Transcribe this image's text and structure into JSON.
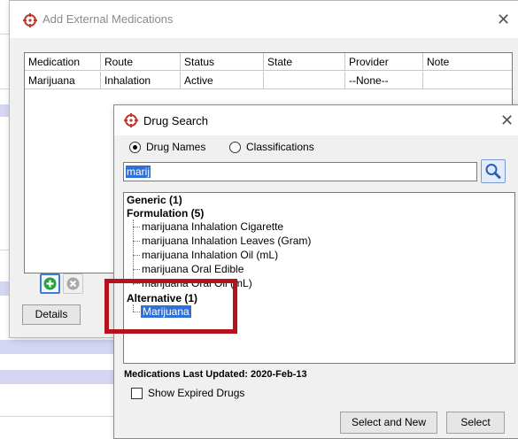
{
  "outer_dialog": {
    "title": "Add External Medications",
    "columns": [
      "Medication",
      "Route",
      "Status",
      "State",
      "Provider",
      "Note"
    ],
    "row": [
      "Marijuana",
      "Inhalation",
      "Active",
      "",
      "--None--",
      ""
    ],
    "details_label": "Details"
  },
  "drug_search": {
    "title": "Drug Search",
    "radio_drug_names": "Drug Names",
    "radio_classifications": "Classifications",
    "search_value": "marij",
    "groups": {
      "generic": "Generic (1)",
      "formulation": "Formulation (5)",
      "alternative": "Alternative (1)"
    },
    "formulations": [
      "marijuana  Inhalation Cigarette",
      "marijuana  Inhalation Leaves (Gram)",
      "marijuana  Inhalation Oil (mL)",
      "marijuana  Oral Edible",
      "marijuana  Oral Oil (mL)"
    ],
    "alternative_item": "Marijuana",
    "last_updated": "Medications Last Updated: 2020-Feb-13",
    "show_expired_label": "Show Expired Drugs",
    "select_and_new_label": "Select and New",
    "select_label": "Select"
  },
  "colors": {
    "accent": "#c0392b",
    "selection": "#2f6fd8",
    "annotation": "#b5121b",
    "add_button": "#2e9e3e"
  }
}
